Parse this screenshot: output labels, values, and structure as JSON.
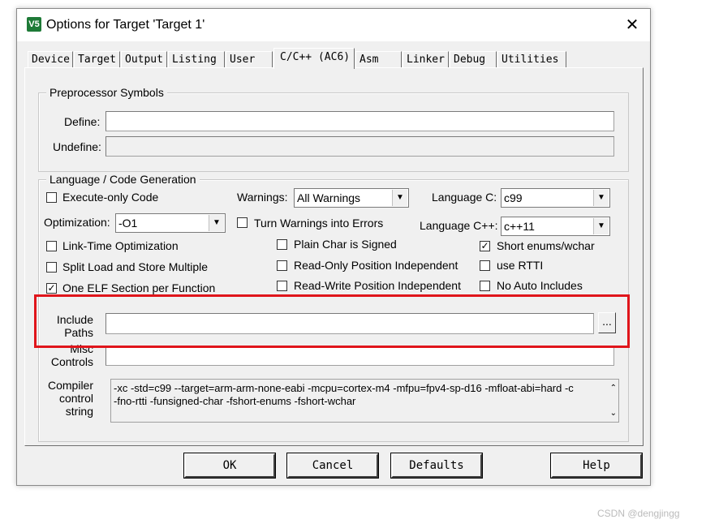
{
  "window": {
    "title": "Options for Target 'Target 1'",
    "app_icon": "V5",
    "close_glyph": "✕"
  },
  "tabs": [
    {
      "label": "Device"
    },
    {
      "label": "Target"
    },
    {
      "label": "Output"
    },
    {
      "label": "Listing"
    },
    {
      "label": "User"
    },
    {
      "label": "C/C++ (AC6)"
    },
    {
      "label": "Asm"
    },
    {
      "label": "Linker"
    },
    {
      "label": "Debug"
    },
    {
      "label": "Utilities"
    }
  ],
  "preprocessor": {
    "group_label": "Preprocessor Symbols",
    "define_label": "Define:",
    "define_value": "",
    "undefine_label": "Undefine:",
    "undefine_value": ""
  },
  "language": {
    "group_label": "Language / Code Generation",
    "execute_only": {
      "label": "Execute-only Code",
      "checked": false
    },
    "warnings_label": "Warnings:",
    "warnings_value": "All Warnings",
    "language_c_label": "Language C:",
    "language_c_value": "c99",
    "optimization_label": "Optimization:",
    "optimization_value": "-O1",
    "turn_warnings": {
      "label": "Turn Warnings into Errors",
      "checked": false
    },
    "language_cpp_label": "Language C++:",
    "language_cpp_value": "c++11",
    "link_time": {
      "label": "Link-Time Optimization",
      "checked": false
    },
    "plain_char": {
      "label": "Plain Char is Signed",
      "checked": false
    },
    "short_enums": {
      "label": "Short enums/wchar",
      "checked": true
    },
    "split_load": {
      "label": "Split Load and Store Multiple",
      "checked": false
    },
    "ropi": {
      "label": "Read-Only Position Independent",
      "checked": false
    },
    "rtti": {
      "label": "use RTTI",
      "checked": false
    },
    "one_elf": {
      "label": "One ELF Section per Function",
      "checked": true
    },
    "rwpi": {
      "label": "Read-Write Position Independent",
      "checked": false
    },
    "no_auto": {
      "label": "No Auto Includes",
      "checked": false
    }
  },
  "include": {
    "label_line1": "Include",
    "label_line2": "Paths",
    "value": "",
    "browse_label": "..."
  },
  "misc": {
    "label_line1": "Misc",
    "label_line2": "Controls",
    "value": ""
  },
  "compiler": {
    "label_line1": "Compiler",
    "label_line2": "control",
    "label_line3": "string",
    "line1": "-xc -std=c99 --target=arm-arm-none-eabi -mcpu=cortex-m4 -mfpu=fpv4-sp-d16 -mfloat-abi=hard -c",
    "line2": "-fno-rtti -funsigned-char -fshort-enums -fshort-wchar"
  },
  "buttons": {
    "ok": "OK",
    "cancel": "Cancel",
    "defaults": "Defaults",
    "help": "Help"
  },
  "watermark": "CSDN @dengjingg",
  "colors": {
    "highlight": "#e0151b",
    "icon_green": "#1e7a37"
  }
}
